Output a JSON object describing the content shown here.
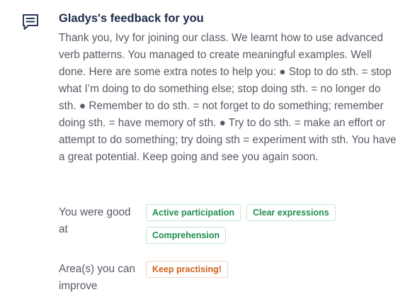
{
  "feedback": {
    "icon": "message-square-lines-icon",
    "title": "Gladys's feedback for you",
    "body": "Thank you, Ivy for joining our class. We learnt how to use advanced verb patterns. You managed to create meaningful examples. Well done. Here are some extra notes to help you: ● Stop to do sth. = stop what I’m doing to do something else; stop doing sth. = no longer do sth. ● Remember to do sth. = not forget to do something; remember doing sth. = have memory of sth. ● Try to do sth. = make an effort or attempt to do something; try doing sth = experiment with sth. You have a great potential. Keep going and see you again soon."
  },
  "good_at": {
    "label": "You were good at",
    "tags": [
      "Active participation",
      "Clear expressions",
      "Comprehension"
    ],
    "tag_color": "#1f8f52"
  },
  "improve": {
    "label": "Area(s) you can improve",
    "tags": [
      "Keep practising!"
    ],
    "tag_color": "#d2611a"
  },
  "colors": {
    "title": "#1c2a4a",
    "body_text": "#555a63",
    "icon": "#2b3a55"
  }
}
